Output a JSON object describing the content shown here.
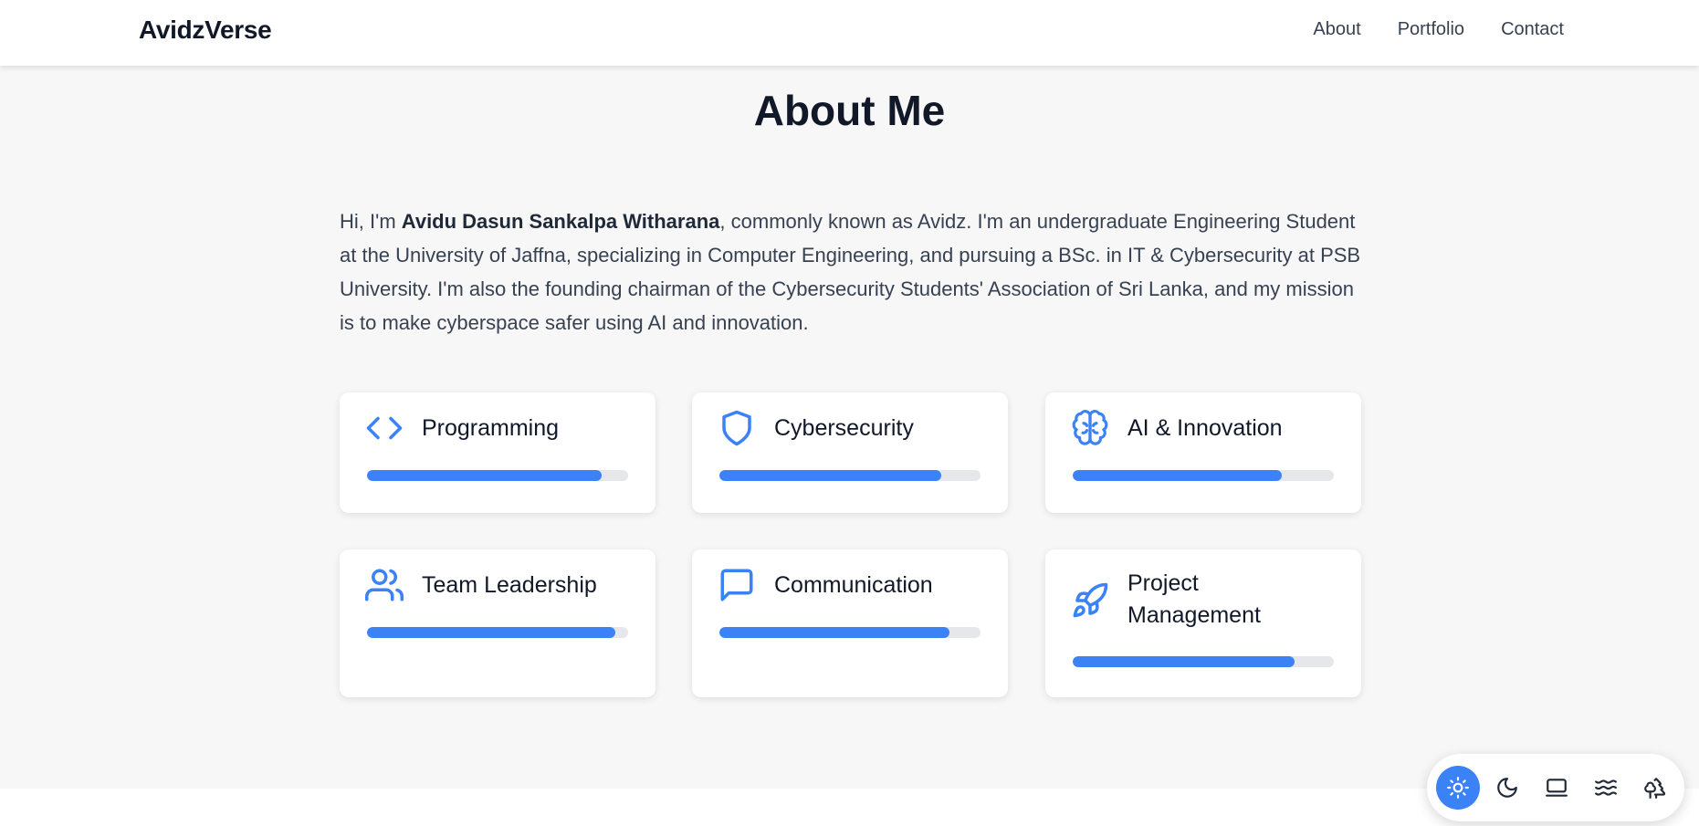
{
  "header": {
    "brand": "AvidzVerse",
    "nav": [
      {
        "label": "About"
      },
      {
        "label": "Portfolio"
      },
      {
        "label": "Contact"
      }
    ]
  },
  "about": {
    "title": "About Me",
    "intro_prefix": "Hi, I'm ",
    "intro_name": "Avidu Dasun Sankalpa Witharana",
    "intro_rest": ", commonly known as Avidz. I'm an undergraduate Engineering Student at the University of Jaffna, specializing in Computer Engineering, and pursuing a BSc. in IT & Cybersecurity at PSB University. I'm also the founding chairman of the Cybersecurity Students' Association of Sri Lanka, and my mission is to make cyberspace safer using AI and innovation."
  },
  "skills": [
    {
      "label": "Programming",
      "icon": "code-icon",
      "level_pct": 90
    },
    {
      "label": "Cybersecurity",
      "icon": "shield-icon",
      "level_pct": 85
    },
    {
      "label": "AI & Innovation",
      "icon": "brain-icon",
      "level_pct": 80
    },
    {
      "label": "Team Leadership",
      "icon": "users-icon",
      "level_pct": 95
    },
    {
      "label": "Communication",
      "icon": "message-square-icon",
      "level_pct": 88
    },
    {
      "label": "Project Management",
      "icon": "rocket-icon",
      "level_pct": 85
    }
  ],
  "theme_switcher": {
    "options": [
      {
        "icon": "sun-icon",
        "active": true
      },
      {
        "icon": "moon-icon",
        "active": false
      },
      {
        "icon": "laptop-icon",
        "active": false
      },
      {
        "icon": "waves-icon",
        "active": false
      },
      {
        "icon": "trees-icon",
        "active": false
      }
    ]
  },
  "colors": {
    "accent": "#3b82f6",
    "track": "#e5e7eb",
    "section_bg": "#f7f7f7",
    "heading": "#111827"
  }
}
